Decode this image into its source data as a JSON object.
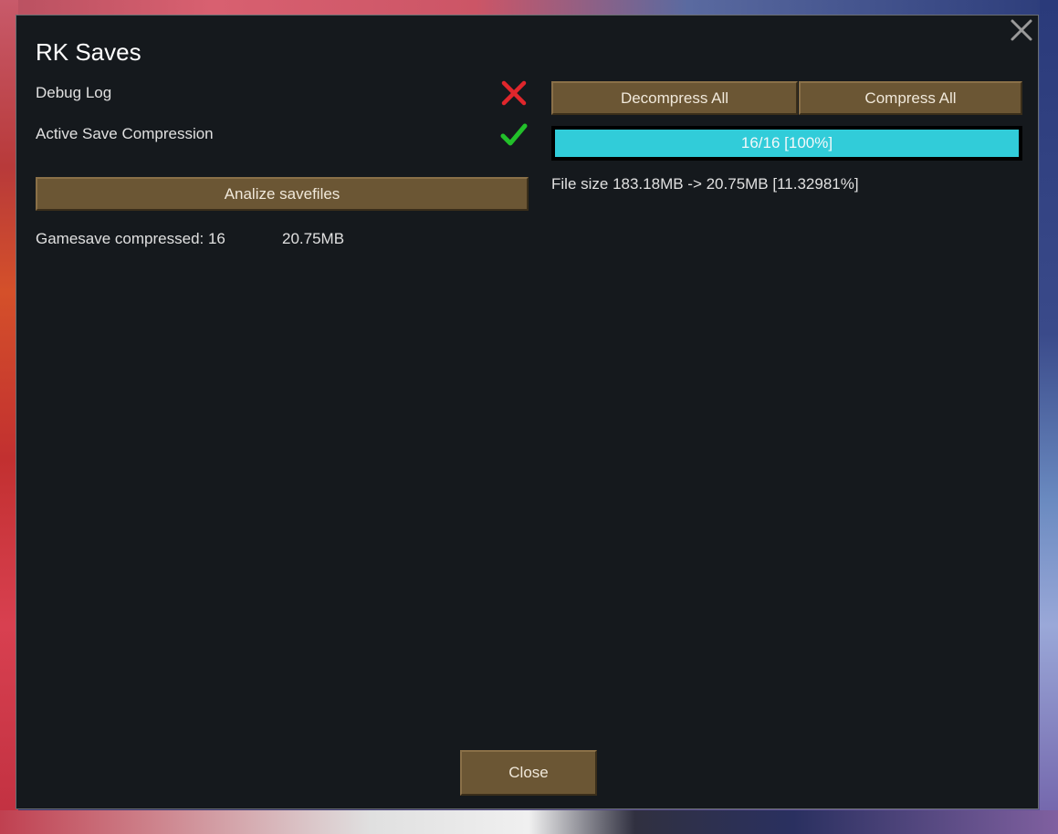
{
  "dialog": {
    "title": "RK Saves",
    "close_icon": "close-icon"
  },
  "settings": {
    "debug_log": {
      "label": "Debug Log",
      "state": "off",
      "icon": "cross-icon",
      "icon_color": "#e0262c"
    },
    "active_save_compression": {
      "label": "Active Save Compression",
      "state": "on",
      "icon": "checkmark-icon",
      "icon_color": "#22c02a"
    }
  },
  "buttons": {
    "analize_label": "Analize savefiles",
    "decompress_all_label": "Decompress All",
    "compress_all_label": "Compress All",
    "close_label": "Close"
  },
  "stats": {
    "gamesave_compressed_label": "Gamesave compressed: 16",
    "gamesave_compressed_size": "20.75MB",
    "file_size_summary": "File size 183.18MB -> 20.75MB [11.32981%]"
  },
  "progress": {
    "text": "16/16 [100%]",
    "fraction": 1.0,
    "color": "#31ccd9"
  }
}
